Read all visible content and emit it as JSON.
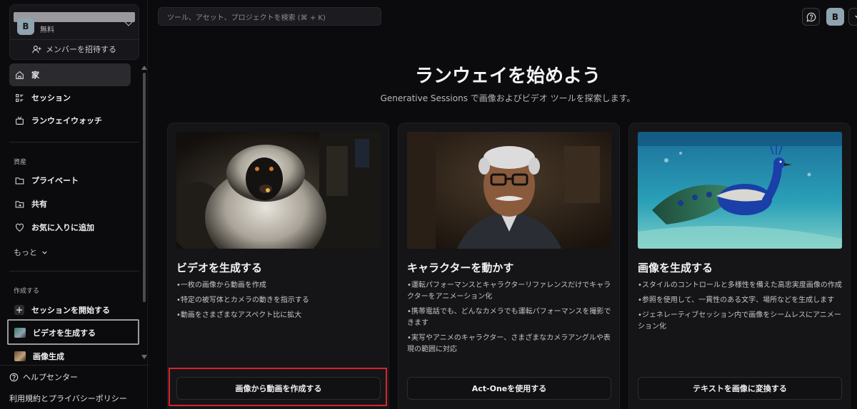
{
  "sidebar": {
    "workspace": {
      "avatar_letter": "B",
      "plan": "無料",
      "invite_label": "メンバーを招待する"
    },
    "nav": [
      {
        "label": "家",
        "icon": "home-icon",
        "active": true
      },
      {
        "label": "セッション",
        "icon": "sessions-icon"
      },
      {
        "label": "ランウェイウォッチ",
        "icon": "tv-icon"
      }
    ],
    "assets_label": "資産",
    "assets": [
      {
        "label": "プライベート",
        "icon": "folder-icon"
      },
      {
        "label": "共有",
        "icon": "shared-folder-icon"
      },
      {
        "label": "お気に入りに追加",
        "icon": "heart-icon"
      }
    ],
    "more_label": "もっと",
    "create_label": "作成する",
    "create": [
      {
        "label": "セッションを開始する",
        "icon": "plus-icon"
      },
      {
        "label": "ビデオを生成する",
        "icon": "video-thumbnail-icon"
      },
      {
        "label": "画像生成",
        "icon": "image-thumbnail-icon"
      }
    ],
    "help_label": "ヘルプセンター",
    "legal_label": "利用規約とプライバシーポリシー"
  },
  "topbar": {
    "search_placeholder": "ツール、アセット、プロジェクトを検索 (⌘ + K)",
    "user_letter": "B"
  },
  "main": {
    "title": "ランウェイを始めよう",
    "subtitle": "Generative Sessions で画像およびビデオ ツールを探索します。",
    "cards": [
      {
        "title": "ビデオを生成する",
        "bullets": [
          "•一枚の画像から動画を作成",
          "•特定の被写体とカメラの動きを指示する",
          "•動画をさまざまなアスペクト比に拡大"
        ],
        "button": "画像から動画を作成する"
      },
      {
        "title": "キャラクターを動かす",
        "bullets": [
          "•運転パフォーマンスとキャラクターリファレンスだけでキャラクターをアニメーション化",
          "•携帯電話でも、どんなカメラでも運転パフォーマンスを撮影できます",
          "•実写やアニメのキャラクター、さまざまなカメラアングルや表現の範囲に対応"
        ],
        "button": "Act-Oneを使用する"
      },
      {
        "title": "画像を生成する",
        "bullets": [
          "•スタイルのコントロールと多様性を備えた高忠実度画像の作成",
          "•参照を使用して、一貫性のある文字、場所などを生成します",
          "•ジェネレーティブセッション内で画像をシームレスにアニメーション化"
        ],
        "button": "テキストを画像に変換する"
      }
    ]
  }
}
